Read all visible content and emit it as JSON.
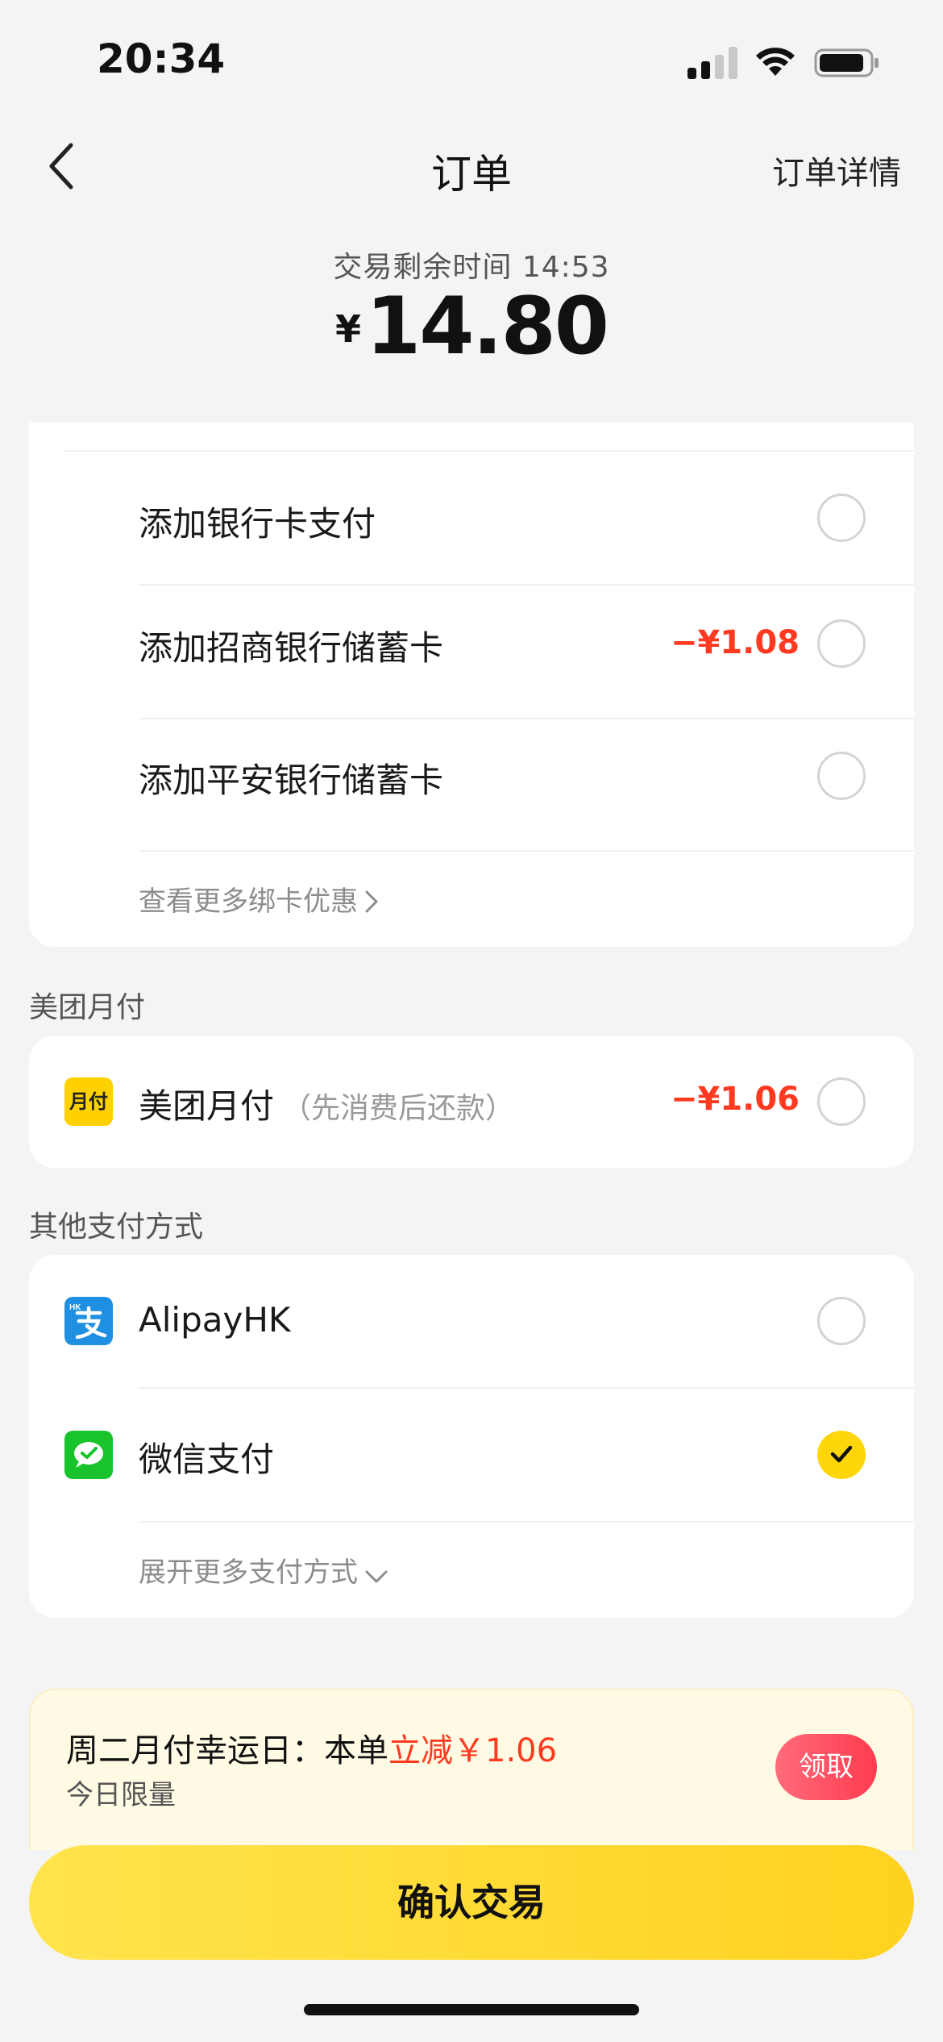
{
  "status_bar": {
    "time": "20:34"
  },
  "nav": {
    "title": "订单",
    "detail_link": "订单详情"
  },
  "summary": {
    "timer_label": "交易剩余时间 14:53",
    "currency": "¥",
    "amount": "14.80"
  },
  "bank_cards": {
    "items": [
      {
        "label": "添加银行卡支付",
        "discount": "",
        "selected": false
      },
      {
        "label": "添加招商银行储蓄卡",
        "discount": "−¥1.08",
        "selected": false
      },
      {
        "label": "添加平安银行储蓄卡",
        "discount": "",
        "selected": false
      }
    ],
    "more_link": "查看更多绑卡优惠"
  },
  "monthly_pay": {
    "section_title": "美团月付",
    "icon_text": "月付",
    "label": "美团月付",
    "sub": "（先消费后还款）",
    "discount": "−¥1.06",
    "selected": false
  },
  "other_methods": {
    "section_title": "其他支付方式",
    "items": [
      {
        "label": "AlipayHK",
        "icon": "alipayhk-icon",
        "selected": false
      },
      {
        "label": "微信支付",
        "icon": "wechat-pay-icon",
        "selected": true
      }
    ],
    "more_link": "展开更多支付方式"
  },
  "promo": {
    "prefix": "周二月付幸运日：本单",
    "highlight": "立减￥1.06",
    "sub": "今日限量",
    "claim_label": "领取"
  },
  "confirm_label": "确认交易",
  "colors": {
    "accent_yellow": "#ffd60a",
    "discount_red": "#ff3a21",
    "claim_red": "#ff4d5e"
  }
}
